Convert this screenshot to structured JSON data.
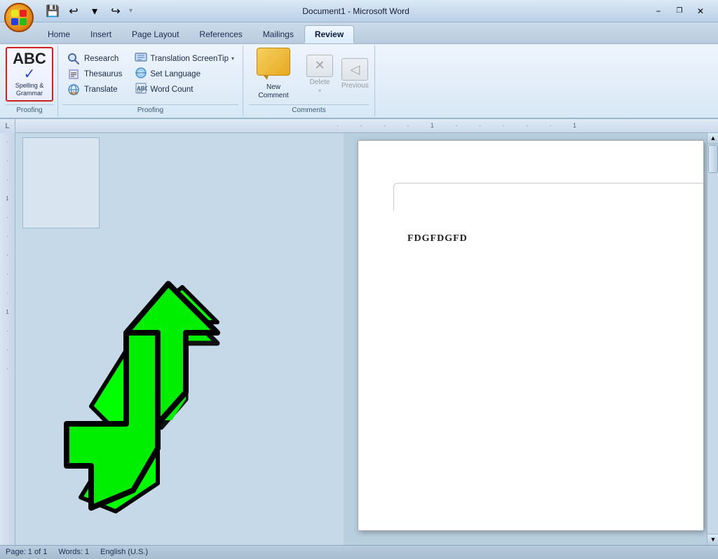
{
  "titlebar": {
    "title": "Document1 - Microsoft Word",
    "quickaccess": {
      "save": "💾",
      "undo": "↩",
      "redo": "↪",
      "customize": "▼"
    }
  },
  "ribbon": {
    "tabs": [
      {
        "label": "Home",
        "active": false
      },
      {
        "label": "Insert",
        "active": false
      },
      {
        "label": "Page Layout",
        "active": false
      },
      {
        "label": "References",
        "active": false
      },
      {
        "label": "Mailings",
        "active": false
      },
      {
        "label": "Review",
        "active": true
      }
    ],
    "groups": {
      "proofing": {
        "label": "Proofing",
        "spelling_label": "Spelling &\nGrammar",
        "abc_text": "ABC",
        "buttons": [
          {
            "icon": "🔍",
            "label": "Research"
          },
          {
            "icon": "📖",
            "label": "Thesaurus"
          },
          {
            "icon": "♿",
            "label": "Translate"
          }
        ],
        "right_buttons": [
          {
            "icon": "🌐",
            "label": "Translation ScreenTip",
            "has_arrow": true
          },
          {
            "icon": "🌍",
            "label": "Set Language"
          },
          {
            "icon": "📊",
            "label": "Word Count"
          }
        ]
      },
      "comments": {
        "label": "Comments",
        "new_label": "New\nComment",
        "delete_label": "Delete",
        "previous_label": "Previous"
      }
    }
  },
  "ruler": {
    "corner_icon": "L",
    "ticks": [
      "·",
      "·",
      "·",
      "1",
      "·",
      "·",
      "·",
      "·",
      "·",
      "1"
    ]
  },
  "document": {
    "content_text": "FDGFDGFD"
  },
  "statusbar": {
    "page_info": "Page: 1 of 1",
    "words": "Words: 1",
    "language": "English (U.S.)"
  }
}
